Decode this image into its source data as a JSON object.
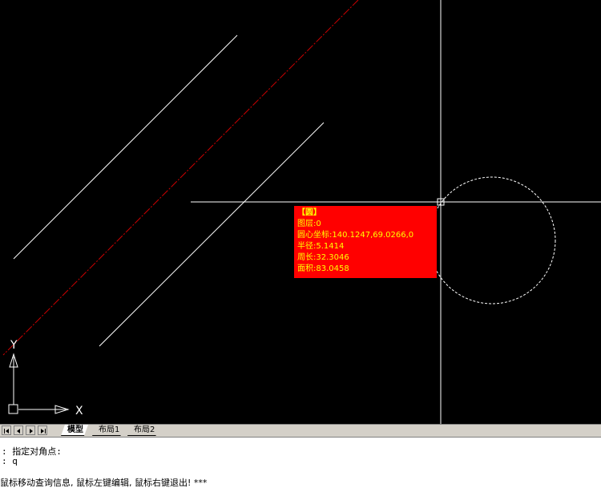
{
  "tooltip": {
    "title": "【圆】",
    "layer": "图层:0",
    "center": "圆心坐标:140.1247,69.0266,0",
    "radius": "半径:5.1414",
    "perimeter": "周长:32.3046",
    "area": "面积:83.0458"
  },
  "ucs": {
    "y_label": "Y",
    "x_label": "X"
  },
  "tabs": [
    {
      "label": "模型",
      "active": true
    },
    {
      "label": "布局1",
      "active": false
    },
    {
      "label": "布局2",
      "active": false
    }
  ],
  "command_lines": [
    ":  指定对角点:",
    ":  q"
  ],
  "status_text": "鼠标移动查询信息, 鼠标左键编辑, 鼠标右键退出! ***",
  "colors": {
    "canvas_bg": "#000000",
    "tooltip_bg": "#ff0000",
    "tooltip_text": "#ffff00",
    "entity_line": "#ffffff",
    "dashed_red_line": "#cc0000"
  }
}
